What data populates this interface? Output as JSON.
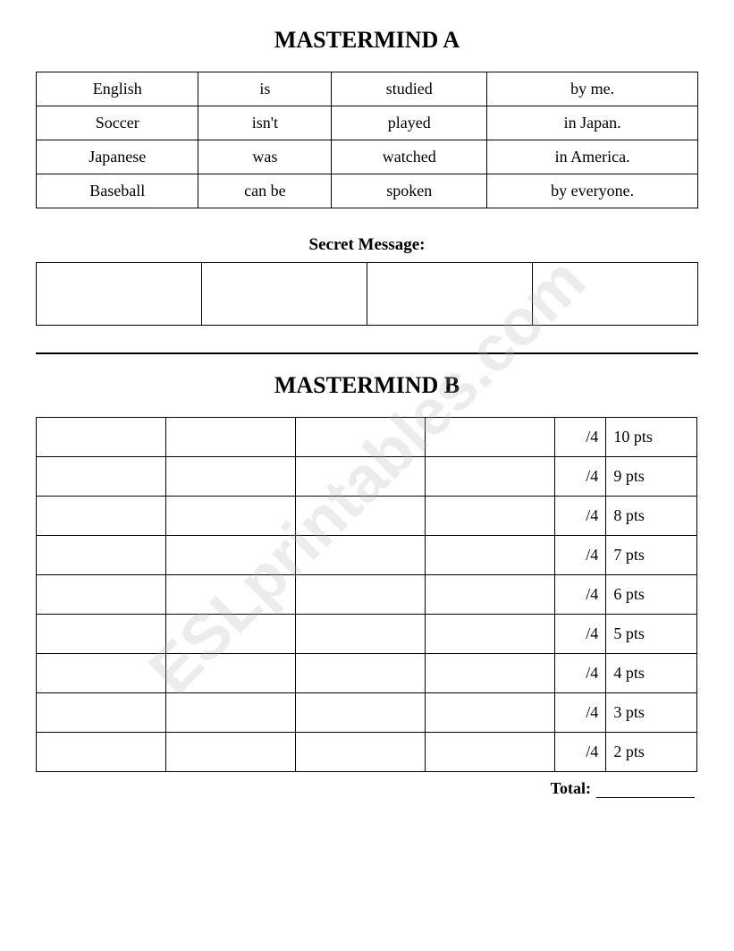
{
  "pageA": {
    "title": "MASTERMIND A",
    "table": {
      "rows": [
        [
          "English",
          "is",
          "studied",
          "by me."
        ],
        [
          "Soccer",
          "isn't",
          "played",
          "in Japan."
        ],
        [
          "Japanese",
          "was",
          "watched",
          "in America."
        ],
        [
          "Baseball",
          "can be",
          "spoken",
          "by everyone."
        ]
      ]
    },
    "secretMessage": {
      "label": "Secret Message:",
      "cells": [
        "",
        "",
        "",
        ""
      ]
    }
  },
  "pageB": {
    "title": "MASTERMIND B",
    "leftRows": 9,
    "rightRows": [
      [
        "/4",
        "10 pts"
      ],
      [
        "/4",
        "9 pts"
      ],
      [
        "/4",
        "8 pts"
      ],
      [
        "/4",
        "7 pts"
      ],
      [
        "/4",
        "6 pts"
      ],
      [
        "/4",
        "5 pts"
      ],
      [
        "/4",
        "4 pts"
      ],
      [
        "/4",
        "3 pts"
      ],
      [
        "/4",
        "2 pts"
      ]
    ],
    "totalLabel": "Total:",
    "watermark": "ESLprintables.com"
  }
}
